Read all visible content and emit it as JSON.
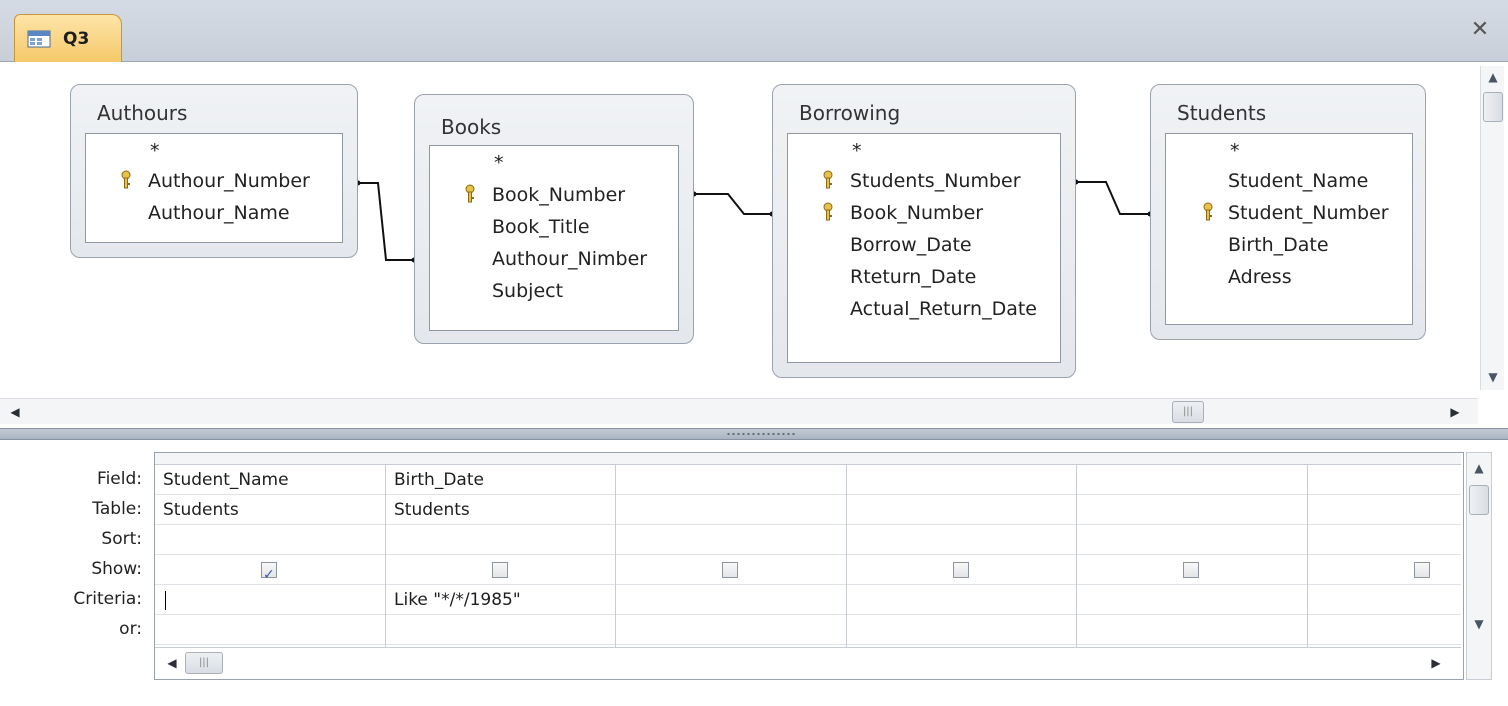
{
  "window": {
    "tab_title": "Q3",
    "tab_icon": "query-icon",
    "close_glyph": "✕"
  },
  "tables": [
    {
      "title": "Authours",
      "fields": [
        {
          "name": "*",
          "key": false
        },
        {
          "name": "Authour_Number",
          "key": true
        },
        {
          "name": "Authour_Name",
          "key": false
        }
      ]
    },
    {
      "title": "Books",
      "fields": [
        {
          "name": "*",
          "key": false
        },
        {
          "name": "Book_Number",
          "key": true
        },
        {
          "name": "Book_Title",
          "key": false
        },
        {
          "name": "Authour_Nimber",
          "key": false
        },
        {
          "name": "Subject",
          "key": false
        }
      ]
    },
    {
      "title": "Borrowing",
      "fields": [
        {
          "name": "*",
          "key": false
        },
        {
          "name": "Students_Number",
          "key": true
        },
        {
          "name": "Book_Number",
          "key": true
        },
        {
          "name": "Borrow_Date",
          "key": false
        },
        {
          "name": "Rteturn_Date",
          "key": false
        },
        {
          "name": "Actual_Return_Date",
          "key": false
        }
      ]
    },
    {
      "title": "Students",
      "fields": [
        {
          "name": "*",
          "key": false
        },
        {
          "name": "Student_Name",
          "key": false
        },
        {
          "name": "Student_Number",
          "key": true
        },
        {
          "name": "Birth_Date",
          "key": false
        },
        {
          "name": "Adress",
          "key": false
        }
      ]
    }
  ],
  "grid": {
    "row_labels": [
      "Field:",
      "Table:",
      "Sort:",
      "Show:",
      "Criteria:",
      "or:"
    ],
    "columns": [
      {
        "field": "Student_Name",
        "table": "Students",
        "sort": "",
        "show": true,
        "criteria": "",
        "or": ""
      },
      {
        "field": "Birth_Date",
        "table": "Students",
        "sort": "",
        "show": false,
        "criteria": "Like \"*/*/1985\"",
        "or": ""
      },
      {
        "field": "",
        "table": "",
        "sort": "",
        "show": false,
        "criteria": "",
        "or": ""
      },
      {
        "field": "",
        "table": "",
        "sort": "",
        "show": false,
        "criteria": "",
        "or": ""
      },
      {
        "field": "",
        "table": "",
        "sort": "",
        "show": false,
        "criteria": "",
        "or": ""
      },
      {
        "field": "",
        "table": "",
        "sort": "",
        "show": false,
        "criteria": "",
        "or": ""
      }
    ]
  },
  "colors": {
    "tab_active": "#f6c96a",
    "chrome": "#c8cfd9",
    "checkbox_accent": "#3a5aa8"
  }
}
